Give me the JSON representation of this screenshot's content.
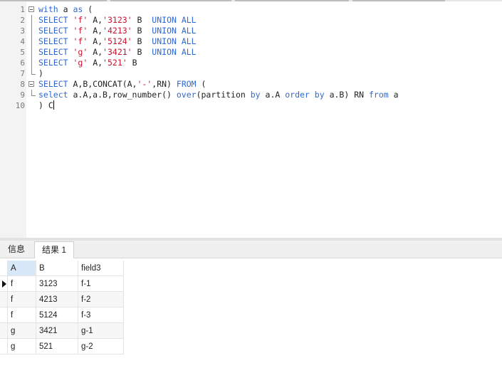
{
  "editor": {
    "lines": [
      {
        "n": "1",
        "parts": [
          {
            "t": "with",
            "c": "kw"
          },
          {
            "t": " a ",
            "c": "pl"
          },
          {
            "t": "as",
            "c": "kw"
          },
          {
            "t": " (",
            "c": "pl"
          }
        ]
      },
      {
        "n": "2",
        "parts": [
          {
            "t": "SELECT",
            "c": "kw"
          },
          {
            "t": " ",
            "c": "pl"
          },
          {
            "t": "'f'",
            "c": "str"
          },
          {
            "t": " A,",
            "c": "pl"
          },
          {
            "t": "'3123'",
            "c": "str"
          },
          {
            "t": " B  ",
            "c": "pl"
          },
          {
            "t": "UNION ALL",
            "c": "kw"
          }
        ]
      },
      {
        "n": "3",
        "parts": [
          {
            "t": "SELECT",
            "c": "kw"
          },
          {
            "t": " ",
            "c": "pl"
          },
          {
            "t": "'f'",
            "c": "str"
          },
          {
            "t": " A,",
            "c": "pl"
          },
          {
            "t": "'4213'",
            "c": "str"
          },
          {
            "t": " B  ",
            "c": "pl"
          },
          {
            "t": "UNION ALL",
            "c": "kw"
          }
        ]
      },
      {
        "n": "4",
        "parts": [
          {
            "t": "SELECT",
            "c": "kw"
          },
          {
            "t": " ",
            "c": "pl"
          },
          {
            "t": "'f'",
            "c": "str"
          },
          {
            "t": " A,",
            "c": "pl"
          },
          {
            "t": "'5124'",
            "c": "str"
          },
          {
            "t": " B  ",
            "c": "pl"
          },
          {
            "t": "UNION ALL",
            "c": "kw"
          }
        ]
      },
      {
        "n": "5",
        "parts": [
          {
            "t": "SELECT",
            "c": "kw"
          },
          {
            "t": " ",
            "c": "pl"
          },
          {
            "t": "'g'",
            "c": "str"
          },
          {
            "t": " A,",
            "c": "pl"
          },
          {
            "t": "'3421'",
            "c": "str"
          },
          {
            "t": " B  ",
            "c": "pl"
          },
          {
            "t": "UNION ALL",
            "c": "kw"
          }
        ]
      },
      {
        "n": "6",
        "parts": [
          {
            "t": "SELECT",
            "c": "kw"
          },
          {
            "t": " ",
            "c": "pl"
          },
          {
            "t": "'g'",
            "c": "str"
          },
          {
            "t": " A,",
            "c": "pl"
          },
          {
            "t": "'521'",
            "c": "str"
          },
          {
            "t": " B",
            "c": "pl"
          }
        ]
      },
      {
        "n": "7",
        "parts": [
          {
            "t": ")",
            "c": "pl"
          }
        ]
      },
      {
        "n": "8",
        "parts": [
          {
            "t": "SELECT",
            "c": "kw"
          },
          {
            "t": " A,B,CONCAT(A,",
            "c": "pl"
          },
          {
            "t": "'-'",
            "c": "str"
          },
          {
            "t": ",RN) ",
            "c": "pl"
          },
          {
            "t": "FROM",
            "c": "kw"
          },
          {
            "t": " (",
            "c": "pl"
          }
        ]
      },
      {
        "n": "9",
        "parts": [
          {
            "t": "select",
            "c": "kw"
          },
          {
            "t": " a.A,a.B,row_number() ",
            "c": "pl"
          },
          {
            "t": "over",
            "c": "kw"
          },
          {
            "t": "(partition ",
            "c": "pl"
          },
          {
            "t": "by",
            "c": "kw"
          },
          {
            "t": " a.A ",
            "c": "pl"
          },
          {
            "t": "order",
            "c": "kw"
          },
          {
            "t": " ",
            "c": "pl"
          },
          {
            "t": "by",
            "c": "kw"
          },
          {
            "t": " a.B) RN ",
            "c": "pl"
          },
          {
            "t": "from",
            "c": "kw"
          },
          {
            "t": " a",
            "c": "pl"
          }
        ]
      },
      {
        "n": "10",
        "parts": [
          {
            "t": ") C",
            "c": "pl"
          }
        ]
      }
    ]
  },
  "tabs": {
    "info": "信息",
    "result": "结果 1"
  },
  "result": {
    "columns": [
      "A",
      "B",
      "field3"
    ],
    "rows": [
      [
        "f",
        "3123",
        "f-1"
      ],
      [
        "f",
        "4213",
        "f-2"
      ],
      [
        "f",
        "5124",
        "f-3"
      ],
      [
        "g",
        "3421",
        "g-1"
      ],
      [
        "g",
        "521",
        "g-2"
      ]
    ]
  }
}
